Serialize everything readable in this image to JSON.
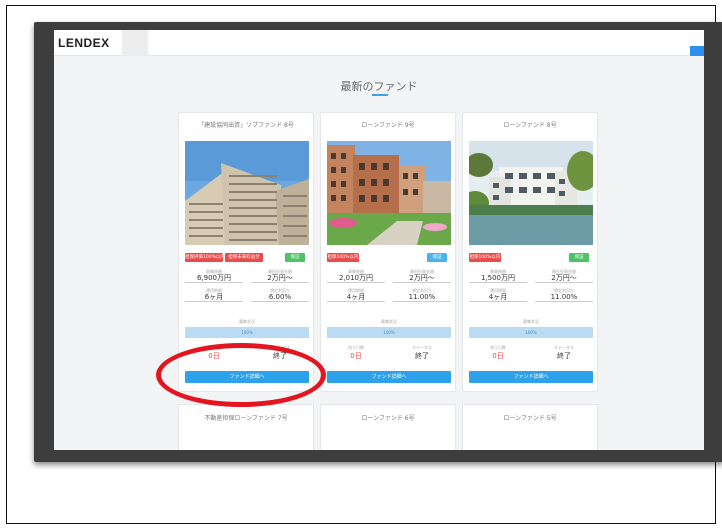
{
  "header": {
    "logo_text": "LENDEX"
  },
  "section": {
    "title": "最新のファンド"
  },
  "labels": {
    "amount": "募集総額",
    "min_invest": "最低投資金額",
    "period": "運用期間",
    "yield": "想定利回り",
    "progress": "募集状況",
    "days_left": "残り日数",
    "status": "ステータス"
  },
  "funds": [
    {
      "name": "「建設協同出資」ソブファンド 8号",
      "tags": [
        "担保評価100%以内",
        "担保未来収益付",
        "保証"
      ],
      "amount": "6,900万円",
      "min_invest": "2万円〜",
      "period": "6ヶ月",
      "yield": "6.00%",
      "progress": "100%",
      "days_left": "0日",
      "status": "終了",
      "button": "ファンド詳細へ"
    },
    {
      "name": "ローンファンド 9号",
      "tags": [
        "担保100%以内",
        "保証"
      ],
      "amount": "2,010万円",
      "min_invest": "2万円〜",
      "period": "4ヶ月",
      "yield": "11.00%",
      "progress": "100%",
      "days_left": "0日",
      "status": "終了",
      "button": "ファンド詳細へ"
    },
    {
      "name": "ローンファンド 8号",
      "tags": [
        "担保100%以内",
        "保証"
      ],
      "amount": "1,500万円",
      "min_invest": "2万円〜",
      "period": "4ヶ月",
      "yield": "11.00%",
      "progress": "100%",
      "days_left": "0日",
      "status": "終了",
      "button": "ファンド詳細へ"
    }
  ],
  "more_funds": [
    {
      "name": "不動産担保ローンファンド 7号"
    },
    {
      "name": "ローンファンド 6号"
    },
    {
      "name": "ローンファンド 5号"
    }
  ],
  "colors": {
    "accent": "#2ea1eb",
    "tag_red": "#ea4a49",
    "tag_green": "#4cc465",
    "highlight": "#e4151e"
  }
}
